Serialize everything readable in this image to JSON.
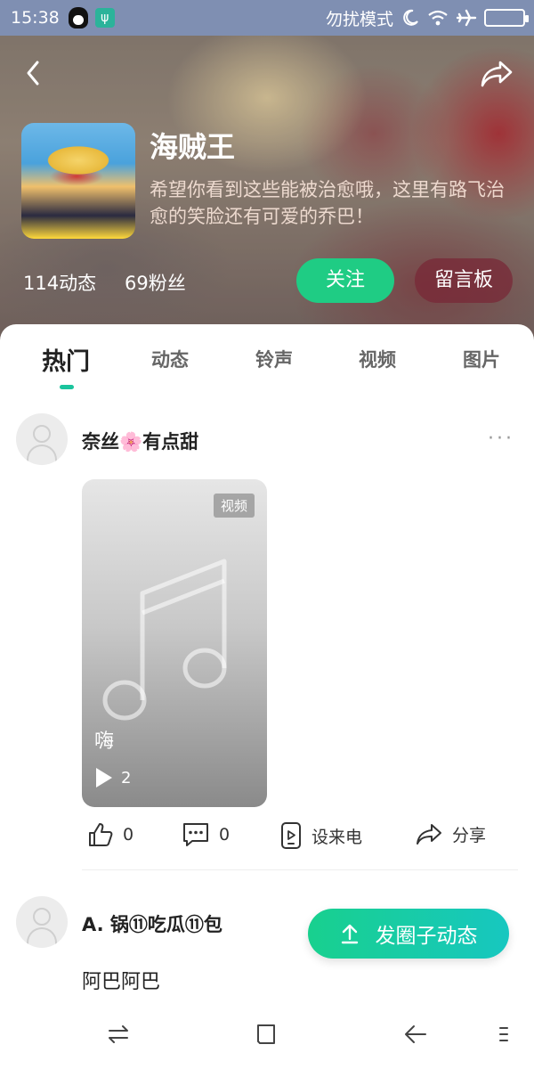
{
  "status_bar": {
    "time": "15:38",
    "dnd_label": "勿扰模式",
    "icons": [
      "qq-icon",
      "usb-icon",
      "moon-icon",
      "wifi-icon",
      "airplane-icon",
      "battery-icon"
    ]
  },
  "header": {
    "title": "海贼王",
    "description": "希望你看到这些能被治愈哦，这里有路飞治愈的笑脸还有可爱的乔巴！",
    "posts_count": "114动态",
    "fans_count": "69粉丝",
    "follow_label": "关注",
    "board_label": "留言板"
  },
  "tabs": [
    {
      "label": "热门",
      "active": true
    },
    {
      "label": "动态",
      "active": false
    },
    {
      "label": "铃声",
      "active": false
    },
    {
      "label": "视频",
      "active": false
    },
    {
      "label": "图片",
      "active": false
    }
  ],
  "post1": {
    "user": "奈丝🌸有点甜",
    "more": "···",
    "video": {
      "tag": "视频",
      "title": "嗨",
      "plays": "2"
    },
    "actions": {
      "likes": "0",
      "comments": "0",
      "set_ringtone": "设来电",
      "share": "分享"
    }
  },
  "post2": {
    "user": "A. 锅⑪吃瓜⑪包",
    "text": "阿巴阿巴"
  },
  "fab": {
    "label": "发圈子动态"
  },
  "colors": {
    "accent": "#1fcc84",
    "tab_indicator": "#1bc49d",
    "status_bar": "#7f8fb2"
  }
}
